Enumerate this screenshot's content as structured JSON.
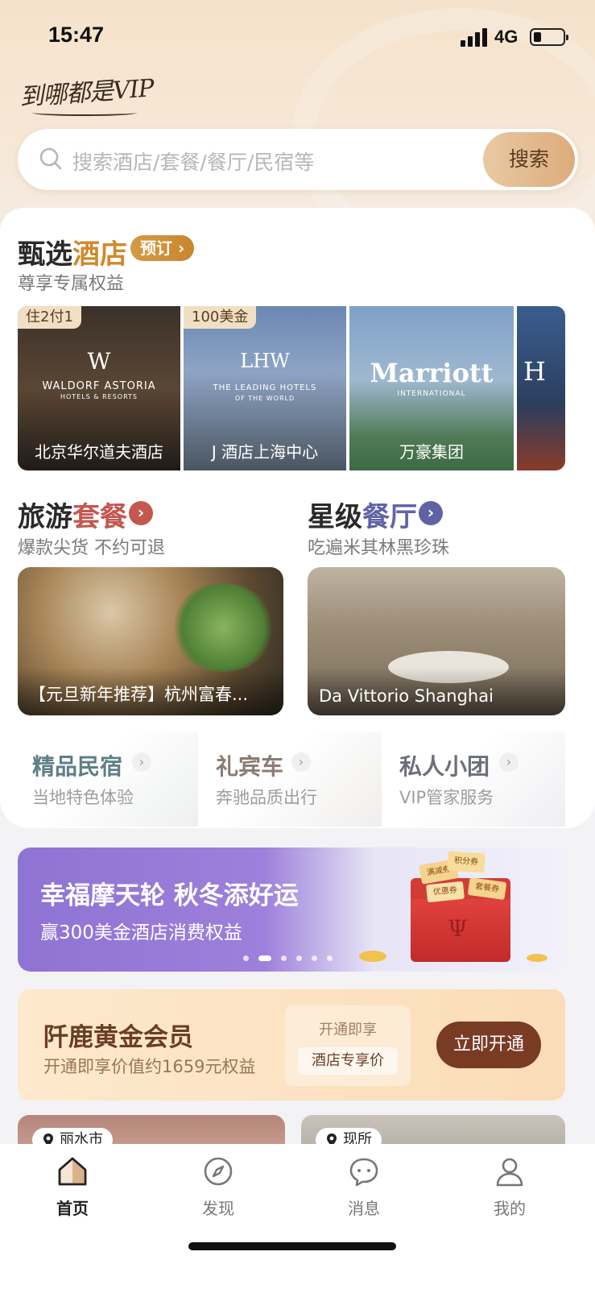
{
  "status_bar": {
    "time": "15:47",
    "network": "4G",
    "battery_level": 0.25
  },
  "header": {
    "slogan": "到哪都是VIP"
  },
  "search": {
    "placeholder": "搜索酒店/套餐/餐厅/民宿等",
    "button_label": "搜索"
  },
  "hotels_section": {
    "title_prefix": "甄选",
    "title_accent": "酒店",
    "badge": "预订",
    "subtitle": "尊享专属权益",
    "items": [
      {
        "tag": "住2付1",
        "logo": "WALDORF ASTORIA",
        "logo_sub": "HOTELS & RESORTS",
        "name": "北京华尔道夫酒店"
      },
      {
        "tag": "100美金",
        "logo": "THE LEADING HOTELS",
        "logo_sub": "OF THE WORLD",
        "name": "J 酒店上海中心"
      },
      {
        "tag": "",
        "logo": "Marriott",
        "logo_sub": "INTERNATIONAL",
        "name": "万豪集团"
      },
      {
        "tag": "",
        "logo": "H",
        "logo_sub": "",
        "name": ""
      }
    ]
  },
  "travel_section": {
    "title_prefix": "旅游",
    "title_accent": "套餐",
    "subtitle": "爆款尖货 不约可退",
    "card_name": "【元旦新年推荐】杭州富春..."
  },
  "dining_section": {
    "title_prefix": "星级",
    "title_accent": "餐厅",
    "subtitle": "吃遍米其林黑珍珠",
    "card_name": "Da Vittorio Shanghai"
  },
  "entries": [
    {
      "title": "精品民宿",
      "subtitle": "当地特色体验",
      "color": "#5e7f86"
    },
    {
      "title": "礼宾车",
      "subtitle": "奔驰品质出行",
      "color": "#8a7c74"
    },
    {
      "title": "私人小团",
      "subtitle": "VIP管家服务",
      "color": "#6b6f79"
    }
  ],
  "banner": {
    "title": "幸福摩天轮 秋冬添好运",
    "subtitle": "赢300美金酒店消费权益",
    "coupon_labels": [
      "积分券",
      "满减券",
      "优惠券",
      "套餐券"
    ],
    "active_dot": 1,
    "dot_count": 6
  },
  "membership": {
    "title": "阡鹿黄金会员",
    "subtitle": "开通即享价值约1659元权益",
    "perk_label": "开通即享",
    "perk_value": "酒店专享价",
    "button_label": "立即开通"
  },
  "locations": [
    {
      "label": "丽水市"
    },
    {
      "label": "现所"
    }
  ],
  "tabs": [
    {
      "label": "首页",
      "icon": "home-icon",
      "active": true
    },
    {
      "label": "发现",
      "icon": "compass-icon",
      "active": false
    },
    {
      "label": "消息",
      "icon": "message-icon",
      "active": false
    },
    {
      "label": "我的",
      "icon": "user-icon",
      "active": false
    }
  ],
  "colors": {
    "accent_gold": "#d2882c",
    "accent_red": "#c4574f",
    "accent_blue": "#5f63a6",
    "member_button": "#7a3b25"
  }
}
